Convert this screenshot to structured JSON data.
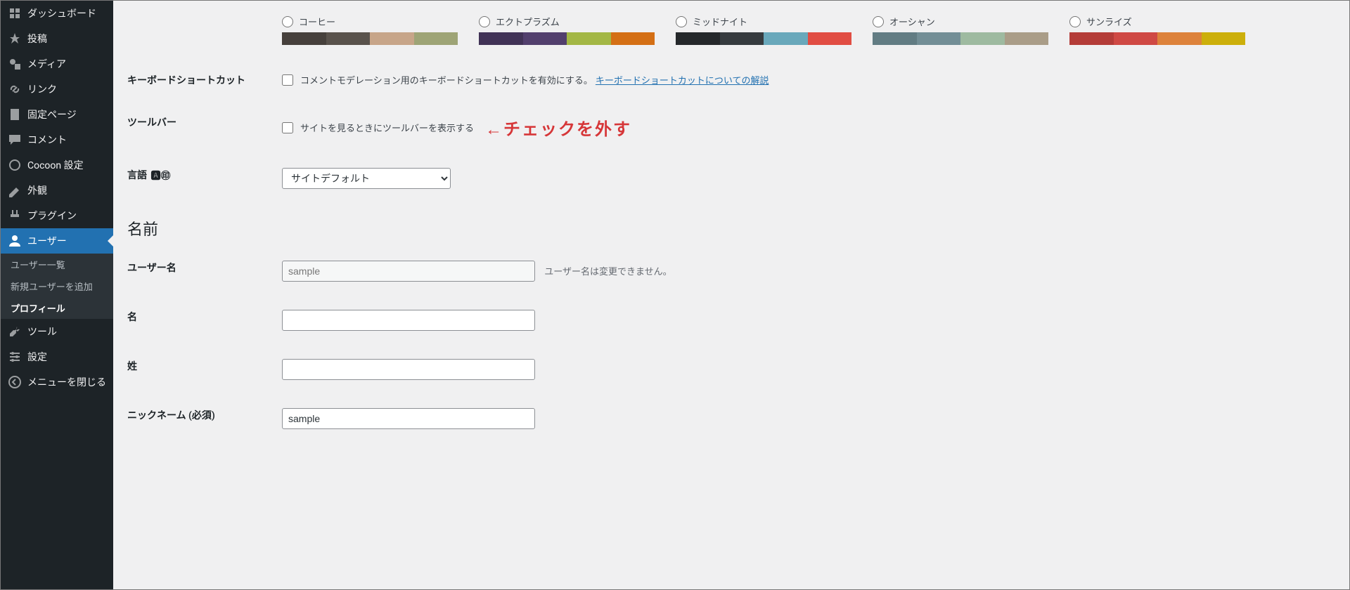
{
  "sidebar": {
    "items": [
      {
        "label": "ダッシュボード",
        "icon": "dashboard-icon"
      },
      {
        "label": "投稿",
        "icon": "pin-icon"
      },
      {
        "label": "メディア",
        "icon": "media-icon"
      },
      {
        "label": "リンク",
        "icon": "link-icon"
      },
      {
        "label": "固定ページ",
        "icon": "page-icon"
      },
      {
        "label": "コメント",
        "icon": "comment-icon"
      },
      {
        "label": "Cocoon 設定",
        "icon": "cocoon-icon"
      },
      {
        "label": "外観",
        "icon": "appearance-icon"
      },
      {
        "label": "プラグイン",
        "icon": "plugin-icon"
      },
      {
        "label": "ユーザー",
        "icon": "user-icon",
        "active": true
      },
      {
        "label": "ツール",
        "icon": "tool-icon"
      },
      {
        "label": "設定",
        "icon": "settings-icon"
      },
      {
        "label": "メニューを閉じる",
        "icon": "collapse-icon"
      }
    ],
    "submenu": [
      {
        "label": "ユーザー一覧"
      },
      {
        "label": "新規ユーザーを追加"
      },
      {
        "label": "プロフィール",
        "current": true
      }
    ]
  },
  "schemes": [
    {
      "name": "コーヒー",
      "colors": [
        "#46403c",
        "#59524c",
        "#c7a589",
        "#9ea476"
      ]
    },
    {
      "name": "エクトプラズム",
      "colors": [
        "#413256",
        "#523f6d",
        "#a3b745",
        "#d46f15"
      ]
    },
    {
      "name": "ミッドナイト",
      "colors": [
        "#25282b",
        "#363b3f",
        "#69a8bb",
        "#e14d43"
      ]
    },
    {
      "name": "オーシャン",
      "colors": [
        "#627c83",
        "#738e96",
        "#9ebaa0",
        "#aa9d88"
      ]
    },
    {
      "name": "サンライズ",
      "colors": [
        "#b43c38",
        "#cf4944",
        "#dd823b",
        "#ccaf0b"
      ]
    }
  ],
  "keyboard": {
    "label": "キーボードショートカット",
    "checkbox_label": "コメントモデレーション用のキーボードショートカットを有効にする。",
    "link_label": "キーボードショートカットについての解説"
  },
  "toolbar": {
    "label": "ツールバー",
    "checkbox_label": "サイトを見るときにツールバーを表示する",
    "annotation": "←チェックを外す"
  },
  "language": {
    "label": "言語",
    "selected": "サイトデフォルト"
  },
  "name_section": {
    "heading": "名前",
    "username_label": "ユーザー名",
    "username_value": "sample",
    "username_note": "ユーザー名は変更できません。",
    "first_label": "名",
    "first_value": "",
    "last_label": "姓",
    "last_value": "",
    "nickname_label": "ニックネーム (必須)",
    "nickname_value": "sample"
  }
}
